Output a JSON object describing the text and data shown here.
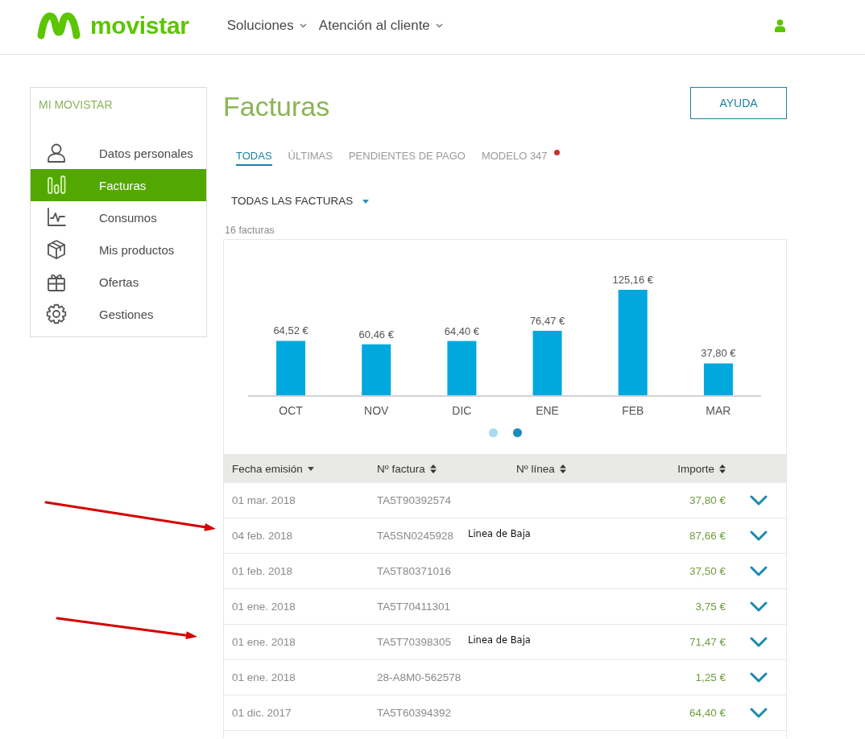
{
  "header": {
    "logo_text": "movistar",
    "nav": [
      {
        "label": "Soluciones"
      },
      {
        "label": "Atención al cliente"
      }
    ]
  },
  "sidebar": {
    "title": "MI MOVISTAR",
    "items": [
      {
        "label": "Datos personales",
        "selected": false
      },
      {
        "label": "Facturas",
        "selected": true
      },
      {
        "label": "Consumos",
        "selected": false
      },
      {
        "label": "Mis productos",
        "selected": false
      },
      {
        "label": "Ofertas",
        "selected": false
      },
      {
        "label": "Gestiones",
        "selected": false
      }
    ]
  },
  "page": {
    "title": "Facturas",
    "help_button": "AYUDA"
  },
  "tabs": [
    {
      "label": "TODAS",
      "selected": true,
      "notification": false
    },
    {
      "label": "ÚLTIMAS",
      "selected": false,
      "notification": false
    },
    {
      "label": "PENDIENTES DE PAGO",
      "selected": false,
      "notification": false
    },
    {
      "label": "MODELO 347",
      "selected": false,
      "notification": true
    }
  ],
  "filter": {
    "label": "TODAS LAS FACTURAS"
  },
  "count": "16 facturas",
  "chart": {
    "chart_data": {
      "type": "bar",
      "categories": [
        "OCT",
        "NOV",
        "DIC",
        "ENE",
        "FEB",
        "MAR"
      ],
      "values": [
        64.52,
        60.46,
        64.4,
        76.47,
        125.16,
        37.8
      ],
      "value_labels": [
        "64,52 €",
        "60,46 €",
        "64,40 €",
        "76,47 €",
        "125,16 €",
        "37,80 €"
      ]
    },
    "pager": [
      {
        "selected": false
      },
      {
        "selected": true
      }
    ]
  },
  "table": {
    "columns": [
      {
        "label": "Fecha emisión",
        "sorted": true
      },
      {
        "label": "Nº factura",
        "sorted": false
      },
      {
        "label": "Nº línea",
        "sorted": false
      },
      {
        "label": "Importe",
        "sorted": false
      }
    ],
    "rows": [
      {
        "date": "01 mar. 2018",
        "invoice": "TA5T90392574",
        "amount": "37,80 €",
        "expanded": false
      },
      {
        "date": "04 feb. 2018",
        "invoice": "TA5SN0245928",
        "line": "Linea de Baja",
        "amount": "87,66 €",
        "expanded": false
      },
      {
        "date": "01 feb. 2018",
        "invoice": "TA5T80371016",
        "amount": "37,50 €",
        "expanded": false
      },
      {
        "date": "01 ene. 2018",
        "invoice": "TA5T70411301",
        "amount": "3,75 €",
        "expanded": false
      },
      {
        "date": "01 ene. 2018",
        "invoice": "TA5T70398305",
        "line": "Linea de Baja",
        "amount": "71,47 €",
        "expanded": false
      },
      {
        "date": "01 ene. 2018",
        "invoice": "28-A8M0-562578",
        "amount": "1,25 €",
        "expanded": false
      },
      {
        "date": "01 dic. 2017",
        "invoice": "TA5T60394392",
        "amount": "64,40 €",
        "expanded": false
      }
    ]
  },
  "annotations": [
    {
      "kind": "arrow"
    },
    {
      "kind": "arrow"
    }
  ]
}
